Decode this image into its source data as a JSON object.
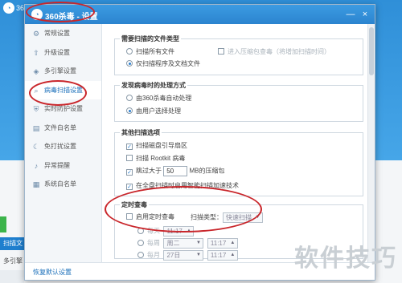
{
  "background": {
    "app_short": "36",
    "left_blue_label": "扫描文",
    "left_text": "多引擎"
  },
  "dialog": {
    "title": "360杀毒 - 设置",
    "minimize_glyph": "—",
    "close_glyph": "×"
  },
  "sidebar": {
    "items": [
      {
        "label": "常规设置",
        "icon": "gear-icon",
        "glyph": "⚙"
      },
      {
        "label": "升级设置",
        "icon": "upload-icon",
        "glyph": "⇧"
      },
      {
        "label": "多引擎设置",
        "icon": "engine-icon",
        "glyph": "◈"
      },
      {
        "label": "病毒扫描设置",
        "icon": "search-icon",
        "glyph": "⌕"
      },
      {
        "label": "实时防护设置",
        "icon": "shield-icon",
        "glyph": "⛨"
      },
      {
        "label": "文件白名单",
        "icon": "file-icon",
        "glyph": "▤"
      },
      {
        "label": "免打扰设置",
        "icon": "moon-icon",
        "glyph": "☾"
      },
      {
        "label": "异常提醒",
        "icon": "bell-icon",
        "glyph": "♪"
      },
      {
        "label": "系统白名单",
        "icon": "list-icon",
        "glyph": "▦"
      }
    ]
  },
  "file_types": {
    "title": "需要扫描的文件类型",
    "opt_all": "扫描所有文件",
    "opt_archive": "进入压缩包查毒（将增加扫描时间）",
    "opt_programs": "仅扫描程序及文档文件"
  },
  "on_virus": {
    "title": "发现病毒时的处理方式",
    "opt_auto": "由360杀毒自动处理",
    "opt_user": "由用户选择处理"
  },
  "other_options": {
    "title": "其他扫描选项",
    "opt_disk_boot": "扫描磁盘引导扇区",
    "opt_rootkit": "扫描 Rootkit 病毒",
    "opt_skip_prefix": "跳过大于",
    "skip_value": "50",
    "opt_skip_suffix": "MB的压缩包",
    "opt_tech": "在全盘扫描时启用智能扫描加速技术"
  },
  "scheduled": {
    "title": "定时查毒",
    "enable_label": "启用定时查毒",
    "scan_type_label": "扫描类型：",
    "scan_type_value": "快速扫描",
    "row1_label": "每天",
    "row1_time": "11:17",
    "row2_label": "每周",
    "row2_day": "周二",
    "row2_time": "11:17",
    "row3_label": "每月",
    "row3_day": "27日",
    "row3_time": "11:17"
  },
  "footer": {
    "restore_defaults": "恢复默认设置"
  },
  "overlay": {
    "brand": "软件技巧"
  },
  "colors": {
    "accent": "#2b84cf",
    "annotation": "#c9262b"
  }
}
